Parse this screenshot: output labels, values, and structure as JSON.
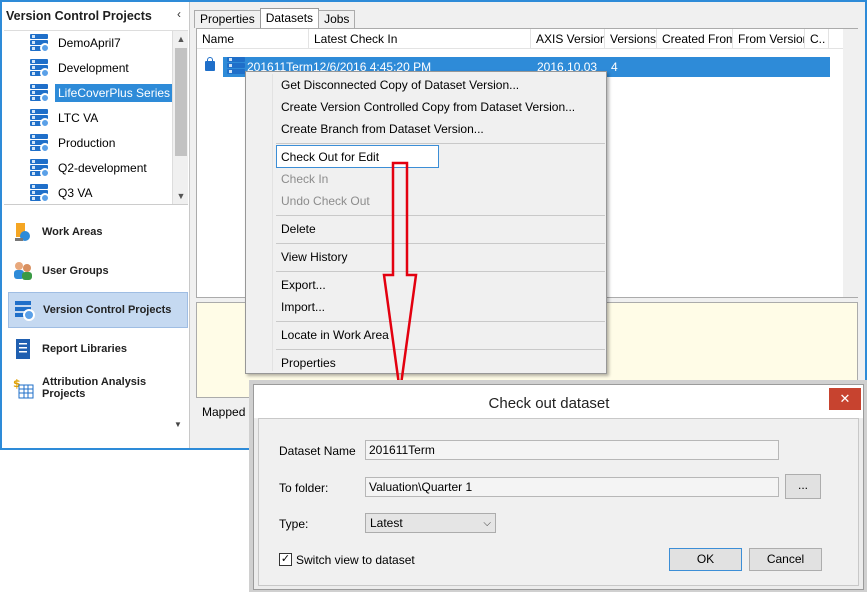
{
  "nav": {
    "title": "Version Control Projects",
    "tree": [
      {
        "label": "DemoApril7",
        "selected": false
      },
      {
        "label": "Development",
        "selected": false
      },
      {
        "label": "LifeCoverPlus Series A",
        "selected": true
      },
      {
        "label": "LTC VA",
        "selected": false
      },
      {
        "label": "Production",
        "selected": false
      },
      {
        "label": "Q2-development",
        "selected": false
      },
      {
        "label": "Q3 VA",
        "selected": false
      }
    ],
    "sections": [
      {
        "label": "Work Areas",
        "icon": "work-areas-icon"
      },
      {
        "label": "User Groups",
        "icon": "user-groups-icon"
      },
      {
        "label": "Version Control Projects",
        "icon": "version-control-icon",
        "active": true
      },
      {
        "label": "Report Libraries",
        "icon": "report-library-icon"
      },
      {
        "label": "Attribution Analysis Projects",
        "icon": "attribution-icon"
      }
    ]
  },
  "tabs": [
    "Properties",
    "Datasets",
    "Jobs"
  ],
  "grid": {
    "columns": [
      "Name",
      "Latest Check In",
      "AXIS Version",
      "Versions",
      "Created From",
      "From Version",
      "C.."
    ],
    "row": {
      "name": "201611Term",
      "latest_check_in": "12/6/2016 4:45:20 PM",
      "axis_version": "2016.10.03",
      "versions": "4"
    }
  },
  "mapped_label": "Mapped Pa",
  "menu": {
    "items": [
      {
        "label": "Get Disconnected Copy of Dataset Version...",
        "disabled": false
      },
      {
        "label": "Create Version Controlled Copy from Dataset Version...",
        "disabled": false
      },
      {
        "label": "Create Branch from Dataset Version...",
        "disabled": false
      },
      {
        "label": "Check Out for Edit",
        "disabled": false,
        "highlighted": true
      },
      {
        "label": "Check In",
        "disabled": true
      },
      {
        "label": "Undo Check Out",
        "disabled": true
      },
      {
        "label": "Delete",
        "disabled": false
      },
      {
        "label": "View History",
        "disabled": false
      },
      {
        "label": "Export...",
        "disabled": false
      },
      {
        "label": "Import...",
        "disabled": false
      },
      {
        "label": "Locate in Work Area",
        "disabled": false
      },
      {
        "label": "Properties",
        "disabled": false
      }
    ]
  },
  "dialog": {
    "title": "Check out dataset",
    "close_glyph": "✕",
    "dataset_name_label": "Dataset Name",
    "dataset_name_value": "201611Term",
    "to_folder_label": "To folder:",
    "to_folder_value": "Valuation\\Quarter 1",
    "browse_label": "...",
    "type_label": "Type:",
    "type_value": "Latest",
    "switch_view_label": "Switch view to dataset",
    "switch_view_checked": true,
    "ok_label": "OK",
    "cancel_label": "Cancel"
  },
  "colors": {
    "accent": "#2e8bd8",
    "close_red": "#c7432f",
    "arrow_red": "#e3000f"
  }
}
